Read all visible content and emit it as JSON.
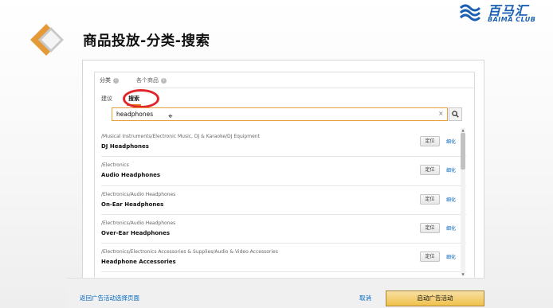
{
  "slide": {
    "title": "商品投放-分类-搜索"
  },
  "brand": {
    "name_cn": "百马汇",
    "name_en": "BAIMA CLUB",
    "color": "#1a5fb4"
  },
  "tabs": {
    "category": "分类",
    "individual_products": "各个商品"
  },
  "sub_tabs": {
    "suggested": "建议",
    "search": "搜索"
  },
  "search": {
    "value": "headphones",
    "clear_glyph": "×"
  },
  "results": [
    {
      "path": "/Musical Instruments/Electronic Music, DJ & Karaoke/DJ Equipment",
      "name": "DJ Headphones",
      "action": "定位",
      "link": "细化"
    },
    {
      "path": "/Electronics",
      "name": "Audio Headphones",
      "action": "定位",
      "link": "细化"
    },
    {
      "path": "/Electronics/Audio Headphones",
      "name": "On-Ear Headphones",
      "action": "定位",
      "link": "细化"
    },
    {
      "path": "/Electronics/Audio Headphones",
      "name": "Over-Ear Headphones",
      "action": "定位",
      "link": "细化"
    },
    {
      "path": "/Electronics/Electronics Accessories & Supplies/Audio & Video Accessories",
      "name": "Headphone Accessories",
      "action": "定位",
      "link": "细化"
    }
  ],
  "footer": {
    "back_link": "返回广告活动选择页面",
    "cancel": "取消",
    "launch": "启动广告活动"
  },
  "colors": {
    "accent_orange": "#e47911",
    "highlight_red": "#e0262a",
    "link_blue": "#0066c0"
  }
}
